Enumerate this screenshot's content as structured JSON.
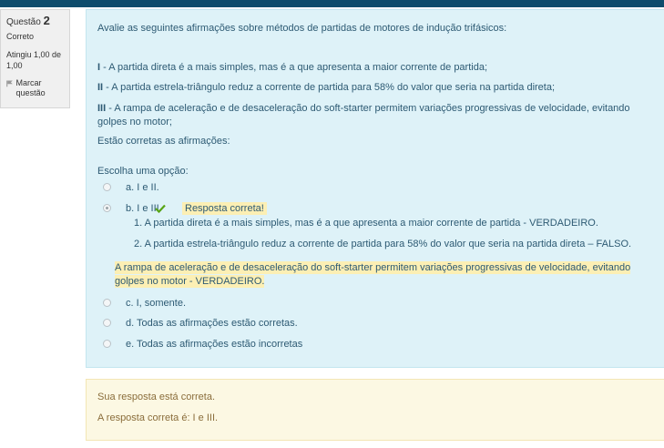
{
  "question_info": {
    "label": "Questão",
    "number": "2",
    "state": "Correto",
    "grade": "Atingiu 1,00 de 1,00",
    "flag_label": "Marcar questão"
  },
  "question": {
    "text": "Avalie as seguintes afirmações sobre métodos de partidas de motores de indução trifásicos:",
    "statements": [
      {
        "num": "I",
        "text": " - A partida direta é a mais simples, mas é a que apresenta a maior corrente de partida;"
      },
      {
        "num": "II",
        "text": " - A partida estrela-triângulo reduz a corrente de partida para 58% do valor que seria na partida direta;"
      },
      {
        "num": "III",
        "text": " - A rampa de aceleração e de desaceleração do soft-starter permitem variações progressivas de velocidade, evitando golpes no motor;"
      }
    ],
    "closing": "Estão corretas as afirmações:",
    "prompt": "Escolha uma opção:"
  },
  "options": [
    {
      "label": "a. I e II."
    },
    {
      "label": "b. I e III."
    },
    {
      "label": "c. I, somente."
    },
    {
      "label": "d. Todas as afirmações estão corretas."
    },
    {
      "label": "e. Todas as afirmações estão incorretas"
    }
  ],
  "selected_feedback": {
    "check_icon": "check-icon",
    "message": "Resposta correta!",
    "items": [
      "A partida direta é a mais simples, mas é a que apresenta a maior corrente de partida - VERDADEIRO.",
      "A partida estrela-triângulo reduz a corrente de partida para 58% do valor que seria na partida direta – FALSO."
    ],
    "highlighted": "A rampa de aceleração e de desaceleração do soft-starter permitem variações progressivas de velocidade, evitando golpes no motor  - VERDADEIRO. "
  },
  "outcome": {
    "general": "Sua resposta está correta.",
    "right_answer": "A resposta correta é: I e III."
  },
  "colors": {
    "header": "#0e4c6c",
    "content_bg": "#def2f8",
    "text": "#2d5a73",
    "highlight": "#fcefb4",
    "check": "#58a516",
    "outcome_bg": "#fcf8e3"
  }
}
